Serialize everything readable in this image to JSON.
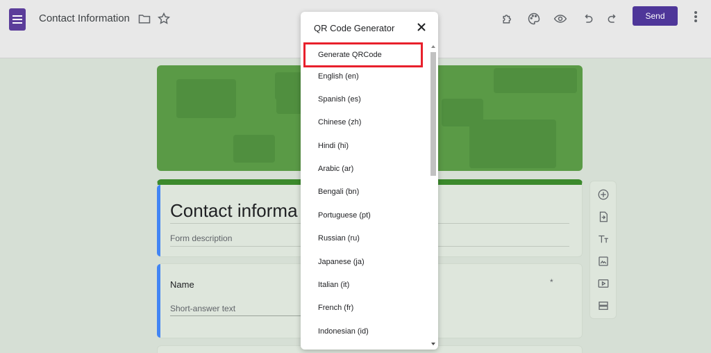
{
  "app": {
    "doc_title": "Contact Information",
    "send_label": "Send"
  },
  "form": {
    "title": "Contact informa",
    "description_placeholder": "Form description",
    "question": {
      "title": "Name",
      "required_marker": "*",
      "hint": "Short-answer text"
    }
  },
  "dialog": {
    "title": "QR Code Generator",
    "items": [
      {
        "label": "Generate QRCode",
        "highlighted": true
      },
      {
        "label": "English (en)"
      },
      {
        "label": "Spanish (es)"
      },
      {
        "label": "Chinese (zh)"
      },
      {
        "label": "Hindi (hi)"
      },
      {
        "label": "Arabic (ar)"
      },
      {
        "label": "Bengali (bn)"
      },
      {
        "label": "Portuguese (pt)"
      },
      {
        "label": "Russian (ru)"
      },
      {
        "label": "Japanese (ja)"
      },
      {
        "label": "Italian (it)"
      },
      {
        "label": "French (fr)"
      },
      {
        "label": "Indonesian (id)"
      }
    ]
  },
  "colors": {
    "brand": "#4e3699",
    "header": "#5a9a46",
    "highlight": "#e8202c",
    "accent": "#4285f4"
  }
}
